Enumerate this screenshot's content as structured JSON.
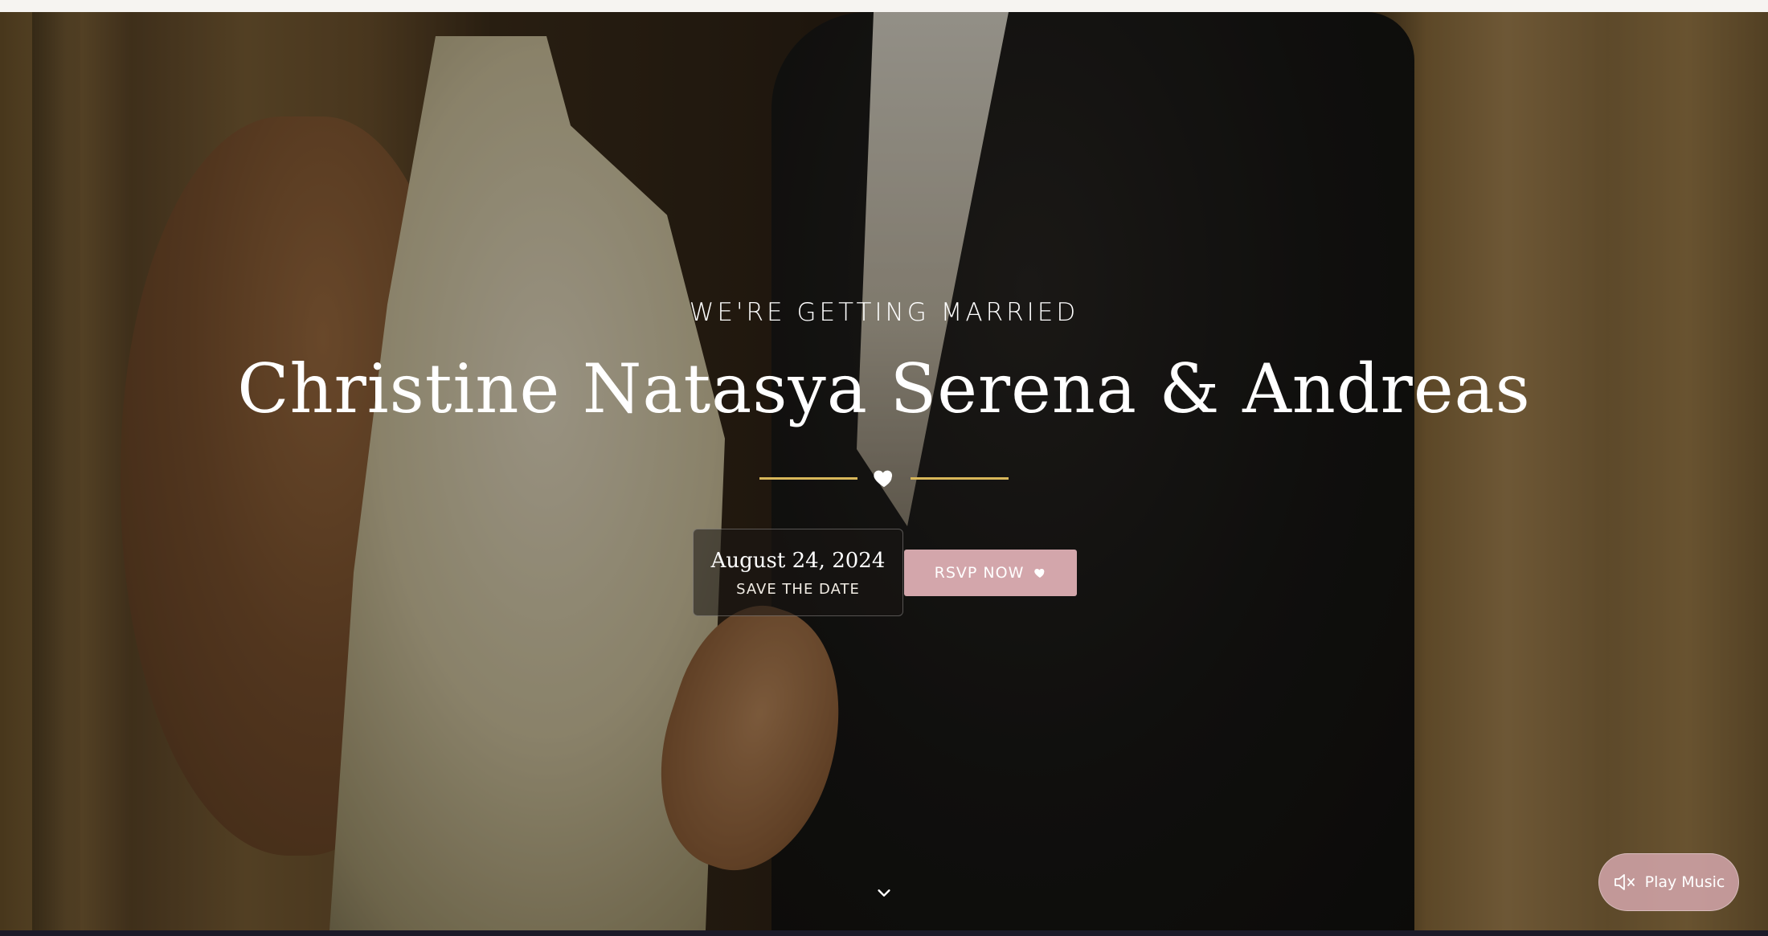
{
  "hero": {
    "eyebrow": "WE'RE GETTING MARRIED",
    "title": "Christine Natasya Serena & Andreas",
    "divider_icon": "heart-icon",
    "accent_color": "#d8b75a"
  },
  "save_the_date": {
    "date": "August 24, 2024",
    "label": "SAVE THE DATE"
  },
  "rsvp_button": {
    "label": "RSVP NOW",
    "icon": "heart-icon",
    "color": "#d3a6ab"
  },
  "scroll_indicator": {
    "icon": "chevron-down-icon"
  },
  "music_button": {
    "label": "Play Music",
    "icon": "speaker-muted-icon",
    "color": "#d3a6ab"
  }
}
